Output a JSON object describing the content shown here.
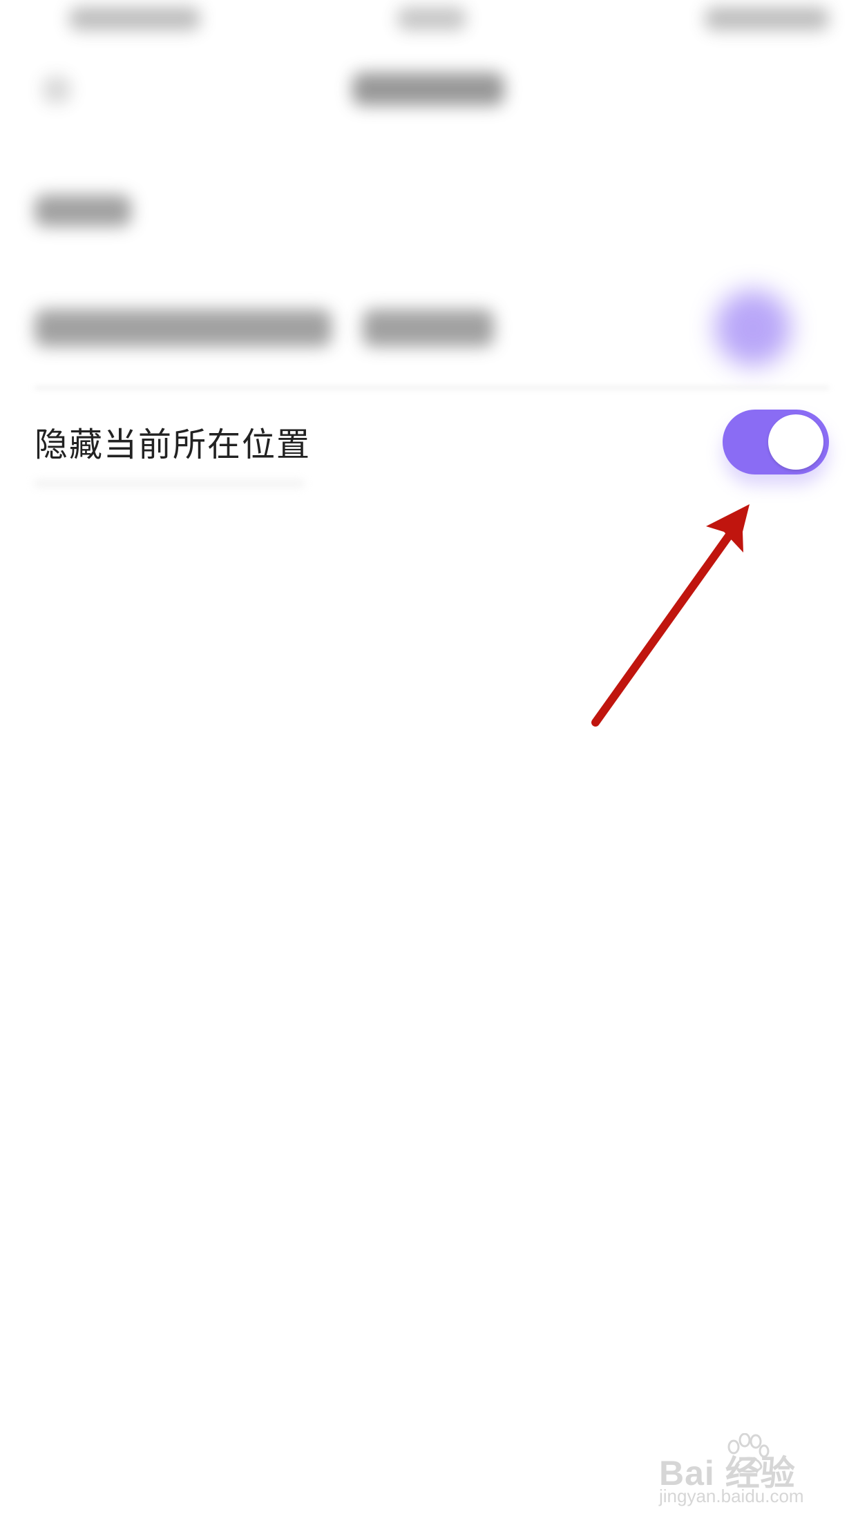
{
  "setting": {
    "label": "隐藏当前所在位置",
    "toggle_state": "on"
  },
  "colors": {
    "toggle_on": "#8a6cf4",
    "arrow": "#c0150e",
    "text": "#222222"
  },
  "watermark": {
    "main": "Bai 经验",
    "sub": "jingyan.baidu.com"
  }
}
